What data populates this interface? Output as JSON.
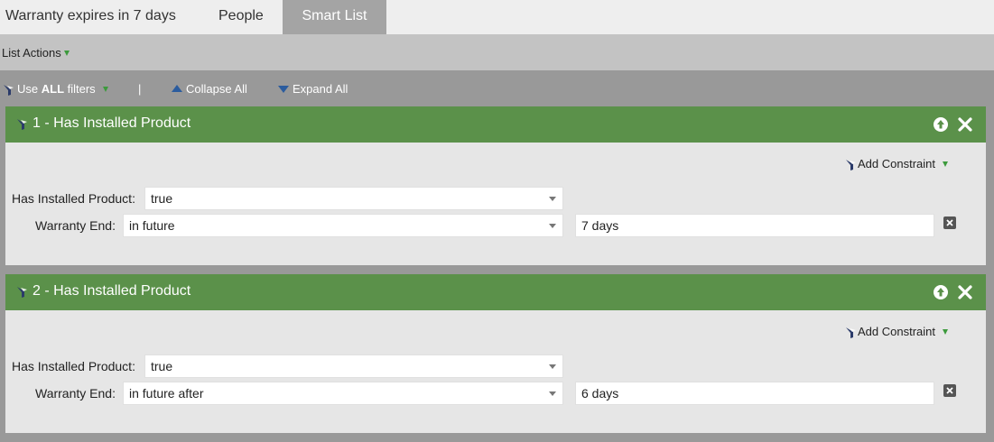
{
  "tabs": [
    {
      "label": "Warranty expires in 7 days"
    },
    {
      "label": "People"
    },
    {
      "label": "Smart List",
      "active": true
    }
  ],
  "actions": {
    "list_actions": "List Actions"
  },
  "filter_toolbar": {
    "use_prefix": "Use ",
    "use_bold": "ALL",
    "use_suffix": " filters",
    "separator": "|",
    "collapse_all": "Collapse All",
    "expand_all": "Expand All"
  },
  "filters": [
    {
      "title": "1 - Has Installed Product",
      "add_constraint": "Add Constraint",
      "has_installed_label": "Has Installed Product:",
      "has_installed_value": "true",
      "warranty_label": "Warranty End:",
      "warranty_operator": "in future",
      "warranty_value": "7 days"
    },
    {
      "title": "2 - Has Installed Product",
      "add_constraint": "Add Constraint",
      "has_installed_label": "Has Installed Product:",
      "has_installed_value": "true",
      "warranty_label": "Warranty End:",
      "warranty_operator": "in future after",
      "warranty_value": "6 days"
    }
  ],
  "colors": {
    "header_green": "#5b914a",
    "active_tab": "#a4a4a4",
    "accent_blue": "#2b5c9e",
    "caret_green": "#3c9a3c"
  },
  "icons": [
    "funnel-icon",
    "chevron-down-icon",
    "collapse-icon",
    "expand-icon",
    "move-up-icon",
    "close-icon",
    "remove-icon"
  ]
}
